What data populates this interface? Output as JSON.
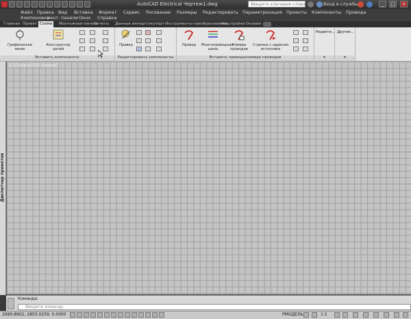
{
  "titlebar": {
    "title": "AutoCAD Electrical   Чертеж1.dwg",
    "search_placeholder": "Введите ключевое слово/фразу",
    "signin": "Вход в службы"
  },
  "menu": {
    "row1": [
      "Файл",
      "Правка",
      "Вид",
      "Вставка",
      "Формат",
      "Сервис",
      "Рисование",
      "Размеры",
      "Редактировать",
      "Параметризация",
      "Проекты",
      "Компоненты",
      "Провода"
    ],
    "row2": [
      "Компоновка",
      "монт. панели",
      "Окно",
      "Справка"
    ]
  },
  "ribbon_tabs": [
    "Главная",
    "Проект",
    "Схема",
    "Монтажная панель",
    "Отчеты",
    "Данные импорт/экспорт",
    "Инструменты преобразования",
    "Надстройки",
    "Онлайн"
  ],
  "ribbon": {
    "graphic_menu": "Графическое меню",
    "circuit_builder": "Конструктор цепей",
    "insert_components": "Вставить компоненты",
    "edit": "Правка",
    "edit_components": "Редактировать компоненты",
    "wire": "Провод",
    "multiwire": "Многопроводная шина",
    "wire_numbers": "Номера проводов",
    "source_arrow": "Стрелка с адресом источника",
    "insert_wires": "Вставить провода/номера проводов",
    "edit_short": "Редакти...",
    "other": "Другие..."
  },
  "drawing": {
    "view_label": "[-][Сверху][2D каркас]"
  },
  "palette": {
    "project_manager": "Диспетчер проектов"
  },
  "command": {
    "label": "Команда:",
    "placeholder": "Введите команду"
  },
  "status": {
    "coords": "2690.8902, 2850.0259, 0.0000",
    "model": "РМОДЕЛЬ",
    "scale": "1:1"
  }
}
